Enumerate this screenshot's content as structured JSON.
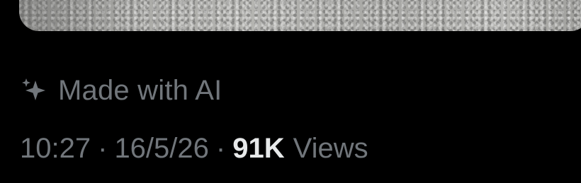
{
  "post": {
    "media": {
      "description_icon": "image-placeholder"
    },
    "ai_label": {
      "icon": "sparkle-icon",
      "text": "Made with AI"
    },
    "meta": {
      "time": "10:27",
      "separator": "·",
      "date": "16/5/26",
      "views_count": "91K",
      "views_label": "Views"
    }
  },
  "colors": {
    "background": "#000000",
    "secondary_text": "#71767b",
    "primary_text": "#e7e9ea"
  }
}
